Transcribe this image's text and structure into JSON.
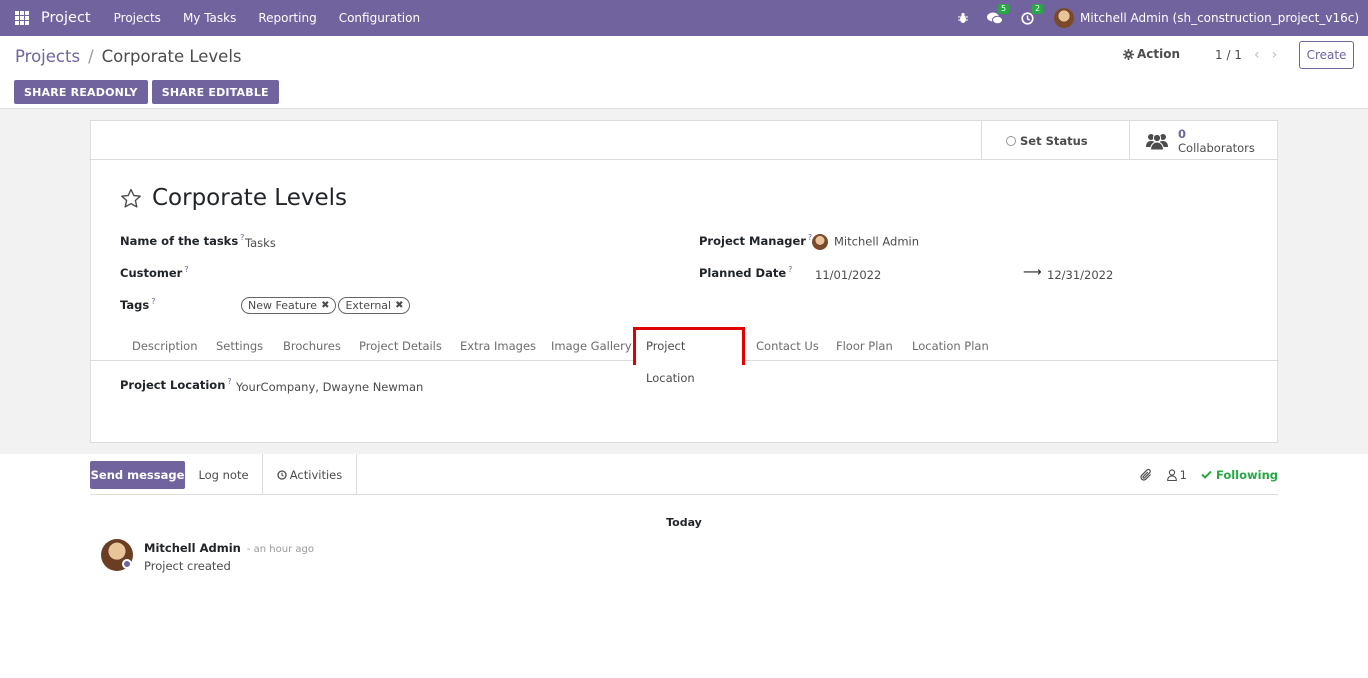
{
  "navbar": {
    "brand": "Project",
    "menu": [
      "Projects",
      "My Tasks",
      "Reporting",
      "Configuration"
    ],
    "messages_count": "5",
    "activities_count": "2",
    "user": "Mitchell Admin (sh_construction_project_v16c)"
  },
  "control": {
    "breadcrumb_parent": "Projects",
    "breadcrumb_sep": "/",
    "breadcrumb_current": "Corporate Levels",
    "action_label": "Action",
    "pager": "1 / 1",
    "create_label": "Create",
    "share_readonly": "SHARE READONLY",
    "share_editable": "SHARE EDITABLE"
  },
  "stats": {
    "set_status": "Set Status",
    "collaborators_count": "0",
    "collaborators_label": "Collaborators"
  },
  "form": {
    "title": "Corporate Levels",
    "tasks_label": "Name of the tasks",
    "tasks_value": "Tasks",
    "customer_label": "Customer",
    "tags_label": "Tags",
    "tags": [
      "New Feature",
      "External"
    ],
    "manager_label": "Project Manager",
    "manager_value": "Mitchell Admin",
    "date_label": "Planned Date",
    "date_start": "11/01/2022",
    "date_end": "12/31/2022",
    "help_mark": "?"
  },
  "tabs": [
    "Description",
    "Settings",
    "Brochures",
    "Project Details",
    "Extra Images",
    "Image Gallery",
    "Project Location",
    "Contact Us",
    "Floor Plan",
    "Location Plan"
  ],
  "location": {
    "label": "Project Location",
    "value": "YourCompany, Dwayne Newman"
  },
  "chatter": {
    "send_message": "Send message",
    "log_note": "Log note",
    "activities": "Activities",
    "followers_count": "1",
    "following": "Following",
    "today": "Today",
    "author": "Mitchell Admin",
    "time": "- an hour ago",
    "body": "Project created"
  },
  "colors": {
    "brand": "#71639e",
    "highlight": "#e00000",
    "success": "#28a745"
  }
}
